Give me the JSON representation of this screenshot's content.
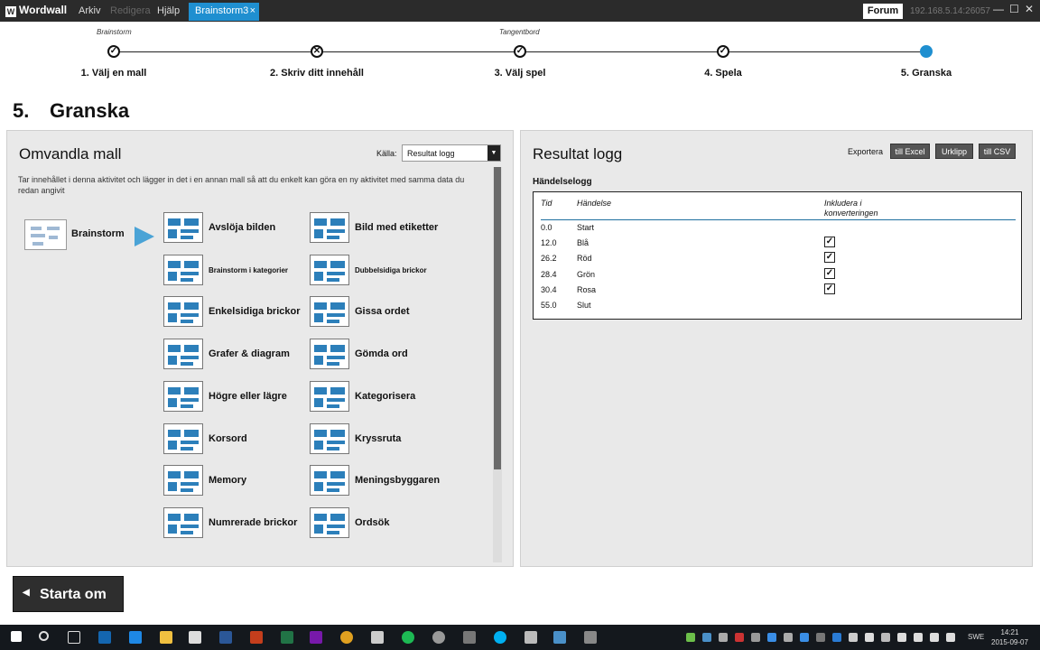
{
  "app": {
    "logo": "Wordwall",
    "menu": [
      "Arkiv",
      "Redigera",
      "Hjälp"
    ],
    "tab": "Brainstorm3",
    "tab_close": "×",
    "forum": "Forum",
    "ip": "192.168.5.14:26057",
    "min": "—",
    "max": "☐",
    "close": "✕"
  },
  "stepper": {
    "top_labels": [
      "Brainstorm",
      "Tangentbord"
    ],
    "steps": [
      {
        "label": "1. Välj en mall",
        "state": "done"
      },
      {
        "label": "2. Skriv ditt innehåll",
        "state": "error"
      },
      {
        "label": "3. Välj spel",
        "state": "done"
      },
      {
        "label": "4. Spela",
        "state": "done"
      },
      {
        "label": "5. Granska",
        "state": "current"
      }
    ],
    "glyph_done": "✓",
    "glyph_error": "✕",
    "glyph_current": ""
  },
  "page": {
    "number": "5.",
    "title": "Granska"
  },
  "left_panel": {
    "title": "Omvandla mall",
    "source_label": "Källa:",
    "source_value": "Resultat logg",
    "description": "Tar innehållet i denna aktivitet och lägger in det i en annan mall så att du enkelt kan göra en ny aktivitet med samma data du redan angivit",
    "current_template": "Brainstorm",
    "templates_col1": [
      "Avslöja bilden",
      "Brainstorm i kategorier",
      "Enkelsidiga brickor",
      "Grafer & diagram",
      "Högre eller lägre",
      "Korsord",
      "Memory",
      "Numrerade brickor"
    ],
    "templates_col2": [
      "Bild med etiketter",
      "Dubbelsidiga brickor",
      "Gissa ordet",
      "Gömda ord",
      "Kategorisera",
      "Kryssruta",
      "Meningsbyggaren",
      "Ordsök"
    ]
  },
  "right_panel": {
    "title": "Resultat logg",
    "export_label": "Exportera",
    "export_buttons": [
      "till Excel",
      "Urklipp",
      "till CSV"
    ],
    "subheading": "Händelselogg",
    "columns": {
      "time": "Tid",
      "event": "Händelse",
      "include": "Inkludera i konverteringen"
    },
    "rows": [
      {
        "time": "0.0",
        "event": "Start",
        "include": null
      },
      {
        "time": "12.0",
        "event": "Blå",
        "include": true
      },
      {
        "time": "26.2",
        "event": "Röd",
        "include": true
      },
      {
        "time": "28.4",
        "event": "Grön",
        "include": true
      },
      {
        "time": "30.4",
        "event": "Rosa",
        "include": true
      },
      {
        "time": "55.0",
        "event": "Slut",
        "include": null
      }
    ],
    "check_glyph": "✓"
  },
  "footer": {
    "restart_chevron": "◀",
    "restart_label": "Starta om"
  },
  "taskbar": {
    "lang": "SWE",
    "time": "14:21",
    "date": "2015-09-07"
  },
  "colors": {
    "accent": "#1f8fd0",
    "titlebar": "#2b2b2b",
    "panel": "#e9e9e9",
    "taskbar": "#14181d"
  }
}
